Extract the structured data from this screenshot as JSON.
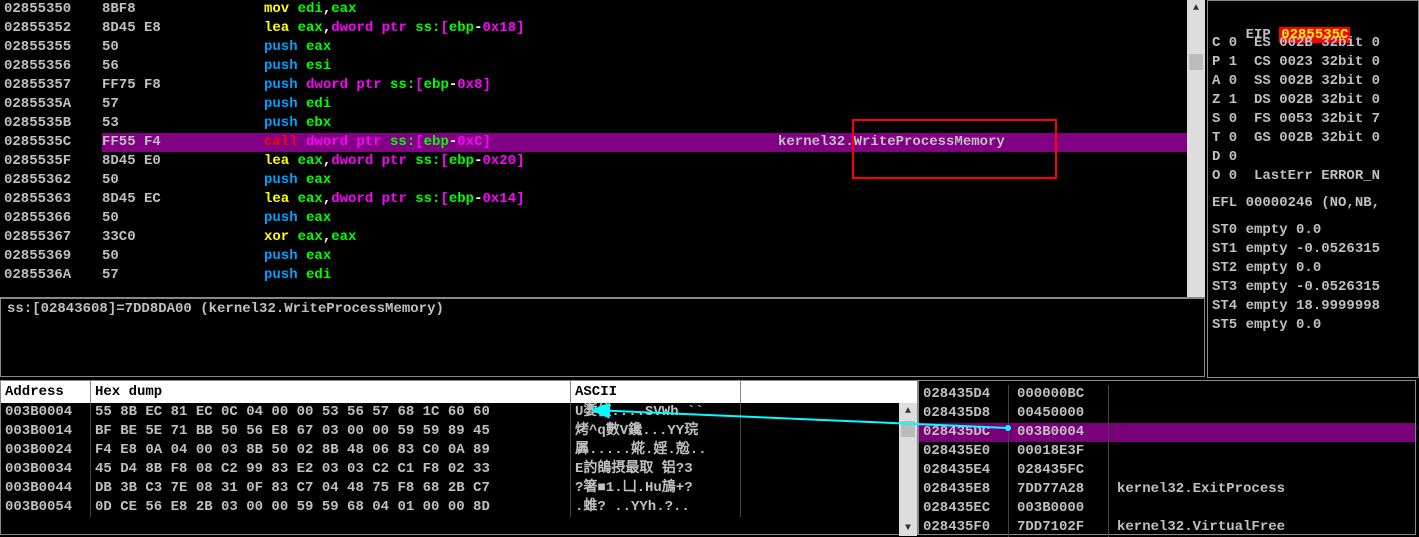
{
  "disasm": {
    "rows": [
      {
        "addr": "02855350",
        "bytes": "8BF8",
        "dis": [
          {
            "t": "mov ",
            "c": "o"
          },
          {
            "t": "edi",
            "c": "r"
          },
          {
            "t": ",",
            "c": "w"
          },
          {
            "t": "eax",
            "c": "r"
          }
        ],
        "cmt": ""
      },
      {
        "addr": "02855352",
        "bytes": "8D45 E8",
        "dis": [
          {
            "t": "lea ",
            "c": "o"
          },
          {
            "t": "eax",
            "c": "r"
          },
          {
            "t": ",",
            "c": "w"
          },
          {
            "t": "dword ptr ",
            "c": "p"
          },
          {
            "t": "ss:",
            "c": "r"
          },
          {
            "t": "[",
            "c": "p"
          },
          {
            "t": "ebp",
            "c": "r"
          },
          {
            "t": "-",
            "c": "w"
          },
          {
            "t": "0x18",
            "c": "p"
          },
          {
            "t": "]",
            "c": "p"
          }
        ],
        "cmt": ""
      },
      {
        "addr": "02855355",
        "bytes": "50",
        "dis": [
          {
            "t": "push ",
            "c": "b"
          },
          {
            "t": "eax",
            "c": "r"
          }
        ],
        "cmt": ""
      },
      {
        "addr": "02855356",
        "bytes": "56",
        "dis": [
          {
            "t": "push ",
            "c": "b"
          },
          {
            "t": "esi",
            "c": "r"
          }
        ],
        "cmt": ""
      },
      {
        "addr": "02855357",
        "bytes": "FF75 F8",
        "dis": [
          {
            "t": "push ",
            "c": "b"
          },
          {
            "t": "dword ptr ",
            "c": "p"
          },
          {
            "t": "ss:",
            "c": "r"
          },
          {
            "t": "[",
            "c": "p"
          },
          {
            "t": "ebp",
            "c": "r"
          },
          {
            "t": "-",
            "c": "w"
          },
          {
            "t": "0x8",
            "c": "p"
          },
          {
            "t": "]",
            "c": "p"
          }
        ],
        "cmt": ""
      },
      {
        "addr": "0285535A",
        "bytes": "57",
        "dis": [
          {
            "t": "push ",
            "c": "b"
          },
          {
            "t": "edi",
            "c": "r"
          }
        ],
        "cmt": ""
      },
      {
        "addr": "0285535B",
        "bytes": "53",
        "dis": [
          {
            "t": "push ",
            "c": "b"
          },
          {
            "t": "ebx",
            "c": "r"
          }
        ],
        "cmt": ""
      },
      {
        "addr": "0285535C",
        "bytes": "FF55 F4",
        "dis": [
          {
            "t": "call ",
            "c": "c"
          },
          {
            "t": "dword ptr ",
            "c": "p"
          },
          {
            "t": "ss:",
            "c": "r"
          },
          {
            "t": "[",
            "c": "p"
          },
          {
            "t": "ebp",
            "c": "r"
          },
          {
            "t": "-",
            "c": "w"
          },
          {
            "t": "0xC",
            "c": "p"
          },
          {
            "t": "]",
            "c": "p"
          }
        ],
        "cmt": "kernel32.WriteProcessMemory",
        "hl": true
      },
      {
        "addr": "0285535F",
        "bytes": "8D45 E0",
        "dis": [
          {
            "t": "lea ",
            "c": "o"
          },
          {
            "t": "eax",
            "c": "r"
          },
          {
            "t": ",",
            "c": "w"
          },
          {
            "t": "dword ptr ",
            "c": "p"
          },
          {
            "t": "ss:",
            "c": "r"
          },
          {
            "t": "[",
            "c": "p"
          },
          {
            "t": "ebp",
            "c": "r"
          },
          {
            "t": "-",
            "c": "w"
          },
          {
            "t": "0x20",
            "c": "p"
          },
          {
            "t": "]",
            "c": "p"
          }
        ],
        "cmt": ""
      },
      {
        "addr": "02855362",
        "bytes": "50",
        "dis": [
          {
            "t": "push ",
            "c": "b"
          },
          {
            "t": "eax",
            "c": "r"
          }
        ],
        "cmt": ""
      },
      {
        "addr": "02855363",
        "bytes": "8D45 EC",
        "dis": [
          {
            "t": "lea ",
            "c": "o"
          },
          {
            "t": "eax",
            "c": "r"
          },
          {
            "t": ",",
            "c": "w"
          },
          {
            "t": "dword ptr ",
            "c": "p"
          },
          {
            "t": "ss:",
            "c": "r"
          },
          {
            "t": "[",
            "c": "p"
          },
          {
            "t": "ebp",
            "c": "r"
          },
          {
            "t": "-",
            "c": "w"
          },
          {
            "t": "0x14",
            "c": "p"
          },
          {
            "t": "]",
            "c": "p"
          }
        ],
        "cmt": ""
      },
      {
        "addr": "02855366",
        "bytes": "50",
        "dis": [
          {
            "t": "push ",
            "c": "b"
          },
          {
            "t": "eax",
            "c": "r"
          }
        ],
        "cmt": ""
      },
      {
        "addr": "02855367",
        "bytes": "33C0",
        "dis": [
          {
            "t": "xor ",
            "c": "o"
          },
          {
            "t": "eax",
            "c": "r"
          },
          {
            "t": ",",
            "c": "w"
          },
          {
            "t": "eax",
            "c": "r"
          }
        ],
        "cmt": ""
      },
      {
        "addr": "02855369",
        "bytes": "50",
        "dis": [
          {
            "t": "push ",
            "c": "b"
          },
          {
            "t": "eax",
            "c": "r"
          }
        ],
        "cmt": ""
      },
      {
        "addr": "0285536A",
        "bytes": "57",
        "dis": [
          {
            "t": "push ",
            "c": "b"
          },
          {
            "t": "edi",
            "c": "r"
          }
        ],
        "cmt": ""
      }
    ]
  },
  "info_line": "ss:[02843608]=7DD8DA00 (kernel32.WriteProcessMemory)",
  "hexdump": {
    "hdr_addr": "Address",
    "hdr_hex": "Hex dump",
    "hdr_asc": "ASCII",
    "rows": [
      {
        "a": "003B0004",
        "h": "55 8B EC 81 EC 0C 04 00 00 53 56 57 68 1C 60 60",
        "s": "U嬱侅....SVWh.``"
      },
      {
        "a": "003B0014",
        "h": "BF BE 5E 71 BB 50 56 E8 67 03 00 00 59 59 89 45",
        "s": "烤^q數V鑱...YY琓"
      },
      {
        "a": "003B0024",
        "h": "F4 E8 0A 04 00 03 8B 50 02 8B 48 06 83 C0 0A 89",
        "s": "羼.....婲.婬.兝.."
      },
      {
        "a": "003B0034",
        "h": "45 D4 8B F8 08 C2 99 83 E2 03 03 C2 C1 F8 02 33",
        "s": "E訋鴭摂最取 铝?3"
      },
      {
        "a": "003B0044",
        "h": "DB 3B C3 7E 08 31 0F 83 C7 04 48 75 F8 68 2B C7",
        "s": "?箸■1.凵.Hu鴋+?"
      },
      {
        "a": "003B0054",
        "h": "0D CE 56 E8 2B 03 00 00 59 59 68 04 01 00 00 8D",
        "s": ".蜼? ..YYh.?.."
      }
    ]
  },
  "stack": {
    "rows": [
      {
        "a": "028435D4",
        "v": "000000BC",
        "c": ""
      },
      {
        "a": "028435D8",
        "v": "00450000",
        "c": ""
      },
      {
        "a": "028435DC",
        "v": "003B0004",
        "c": "",
        "hl": true
      },
      {
        "a": "028435E0",
        "v": "00018E3F",
        "c": ""
      },
      {
        "a": "028435E4",
        "v": "028435FC",
        "c": ""
      },
      {
        "a": "028435E8",
        "v": "7DD77A28",
        "c": "kernel32.ExitProcess"
      },
      {
        "a": "028435EC",
        "v": "003B0000",
        "c": ""
      },
      {
        "a": "028435F0",
        "v": "7DD7102F",
        "c": "kernel32.VirtualFree"
      }
    ]
  },
  "registers": {
    "eip_label": "EIP ",
    "eip_value": "0285535C",
    "flags": [
      "C 0  ES 002B 32bit 0",
      "P 1  CS 0023 32bit 0",
      "A 0  SS 002B 32bit 0",
      "Z 1  DS 002B 32bit 0",
      "S 0  FS 0053 32bit 7",
      "T 0  GS 002B 32bit 0",
      "D 0",
      "O 0  LastErr ERROR_N"
    ],
    "efl": "EFL 00000246 (NO,NB,",
    "fpu": [
      "ST0 empty 0.0",
      "ST1 empty -0.0526315",
      "ST2 empty 0.0",
      "ST3 empty -0.0526315",
      "ST4 empty 18.9999998",
      "ST5 empty 0.0"
    ]
  }
}
